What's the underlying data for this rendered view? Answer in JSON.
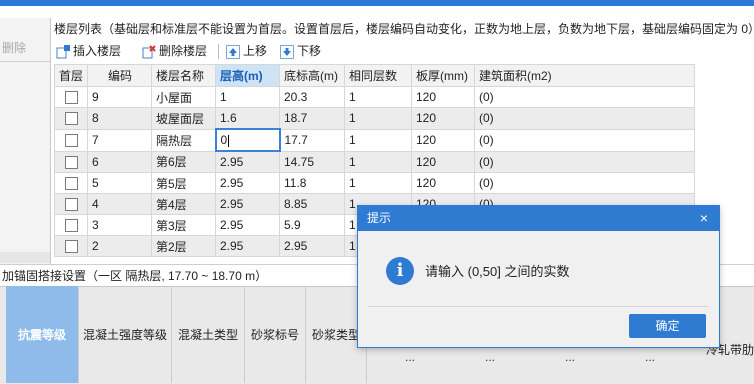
{
  "left_panel": {
    "delete_label": "删除"
  },
  "info_text": "楼层列表（基础层和标准层不能设置为首层。设置首层后，楼层编码自动变化，正数为地上层，负数为地下层，基础层编码固定为 0）",
  "toolbar": {
    "insert_label": "插入楼层",
    "delete_label": "删除楼层",
    "up_label": "上移",
    "down_label": "下移"
  },
  "table": {
    "headers": [
      "首层",
      "编码",
      "楼层名称",
      "层高(m)",
      "底标高(m)",
      "相同层数",
      "板厚(mm)",
      "建筑面积(m2)"
    ],
    "selected_header": "层高(m)",
    "rows": [
      {
        "code": "9",
        "name": "小屋面",
        "height": "1",
        "base": "20.3",
        "same": "1",
        "thick": "120",
        "area": "(0)"
      },
      {
        "code": "8",
        "name": "坡屋面层",
        "height": "1.6",
        "base": "18.7",
        "same": "1",
        "thick": "120",
        "area": "(0)"
      },
      {
        "code": "7",
        "name": "隔热层",
        "height": "0",
        "base": "17.7",
        "same": "1",
        "thick": "120",
        "area": "(0)"
      },
      {
        "code": "6",
        "name": "第6层",
        "height": "2.95",
        "base": "14.75",
        "same": "1",
        "thick": "120",
        "area": "(0)"
      },
      {
        "code": "5",
        "name": "第5层",
        "height": "2.95",
        "base": "11.8",
        "same": "1",
        "thick": "120",
        "area": "(0)"
      },
      {
        "code": "4",
        "name": "第4层",
        "height": "2.95",
        "base": "8.85",
        "same": "1",
        "thick": "120",
        "area": "(0)"
      },
      {
        "code": "3",
        "name": "第3层",
        "height": "2.95",
        "base": "5.9",
        "same": "1",
        "thick": "",
        "area": ""
      },
      {
        "code": "2",
        "name": "第2层",
        "height": "2.95",
        "base": "2.95",
        "same": "1",
        "thick": "",
        "area": ""
      }
    ]
  },
  "status_text": "加锚固搭接设置（一区  隔热层, 17.70 ~ 18.70 m）",
  "bottom_headers": [
    "抗震等级",
    "混凝土强度等级",
    "混凝土类型",
    "砂浆标号",
    "砂浆类型"
  ],
  "bottom_dots": "...",
  "bottom_right_label": "冷轧带肋",
  "dialog": {
    "title": "提示",
    "close_glyph": "×",
    "icon_glyph": "i",
    "message": "请输入 (0,50] 之间的实数",
    "ok_label": "确定"
  },
  "colors": {
    "accent": "#2e7bd1",
    "active_tab": "#8ebbea"
  }
}
